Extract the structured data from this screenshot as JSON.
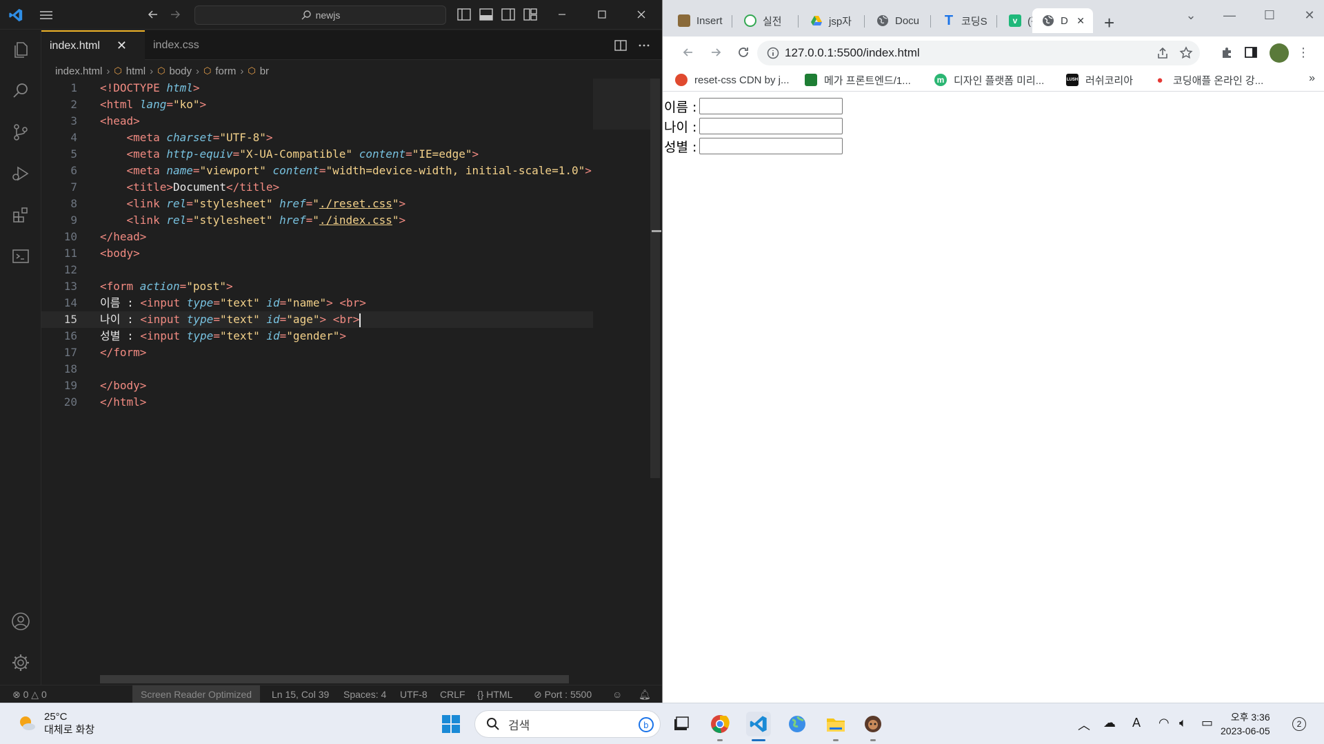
{
  "vscode": {
    "search_text": "newjs",
    "tabs": [
      {
        "label": "index.html",
        "active": true,
        "close": "✕"
      },
      {
        "label": "index.css",
        "active": false
      }
    ],
    "breadcrumb": [
      "index.html",
      "html",
      "body",
      "form",
      "br"
    ],
    "status": {
      "problems": "⊗ 0 △ 0",
      "screen_reader": "Screen Reader Optimized",
      "position": "Ln 15, Col 39",
      "spaces": "Spaces: 4",
      "encoding": "UTF-8",
      "eol": "CRLF",
      "language": "{} HTML",
      "port": "⊘ Port : 5500"
    },
    "current_line": 15,
    "code_lines": [
      [
        [
          "tag",
          "<!DOCTYPE "
        ],
        [
          "attr",
          "html"
        ],
        [
          "tag",
          ">"
        ]
      ],
      [
        [
          "tag",
          "<html "
        ],
        [
          "attr",
          "lang"
        ],
        [
          "tag",
          "="
        ],
        [
          "str",
          "\"ko\""
        ],
        [
          "tag",
          ">"
        ]
      ],
      [
        [
          "tag",
          "<head>"
        ]
      ],
      [
        [
          "txt",
          "    "
        ],
        [
          "tag",
          "<meta "
        ],
        [
          "attr",
          "charset"
        ],
        [
          "tag",
          "="
        ],
        [
          "str",
          "\"UTF-8\""
        ],
        [
          "tag",
          ">"
        ]
      ],
      [
        [
          "txt",
          "    "
        ],
        [
          "tag",
          "<meta "
        ],
        [
          "attr",
          "http-equiv"
        ],
        [
          "tag",
          "="
        ],
        [
          "str",
          "\"X-UA-Compatible\""
        ],
        [
          "txt",
          " "
        ],
        [
          "attr",
          "content"
        ],
        [
          "tag",
          "="
        ],
        [
          "str",
          "\"IE=edge\""
        ],
        [
          "tag",
          ">"
        ]
      ],
      [
        [
          "txt",
          "    "
        ],
        [
          "tag",
          "<meta "
        ],
        [
          "attr",
          "name"
        ],
        [
          "tag",
          "="
        ],
        [
          "str",
          "\"viewport\""
        ],
        [
          "txt",
          " "
        ],
        [
          "attr",
          "content"
        ],
        [
          "tag",
          "="
        ],
        [
          "str",
          "\"width=device-width, initial-scale=1.0\""
        ],
        [
          "tag",
          ">"
        ]
      ],
      [
        [
          "txt",
          "    "
        ],
        [
          "tag",
          "<title>"
        ],
        [
          "txt",
          "Document"
        ],
        [
          "tag",
          "</title>"
        ]
      ],
      [
        [
          "txt",
          "    "
        ],
        [
          "tag",
          "<link "
        ],
        [
          "attr",
          "rel"
        ],
        [
          "tag",
          "="
        ],
        [
          "str",
          "\"stylesheet\""
        ],
        [
          "txt",
          " "
        ],
        [
          "attr",
          "href"
        ],
        [
          "tag",
          "="
        ],
        [
          "str",
          "\""
        ],
        [
          "stru",
          "./reset.css"
        ],
        [
          "str",
          "\""
        ],
        [
          "tag",
          ">"
        ]
      ],
      [
        [
          "txt",
          "    "
        ],
        [
          "tag",
          "<link "
        ],
        [
          "attr",
          "rel"
        ],
        [
          "tag",
          "="
        ],
        [
          "str",
          "\"stylesheet\""
        ],
        [
          "txt",
          " "
        ],
        [
          "attr",
          "href"
        ],
        [
          "tag",
          "="
        ],
        [
          "str",
          "\""
        ],
        [
          "stru",
          "./index.css"
        ],
        [
          "str",
          "\""
        ],
        [
          "tag",
          ">"
        ]
      ],
      [
        [
          "tag",
          "</head>"
        ]
      ],
      [
        [
          "tag",
          "<body>"
        ]
      ],
      [],
      [
        [
          "tag",
          "<form "
        ],
        [
          "attr",
          "action"
        ],
        [
          "tag",
          "="
        ],
        [
          "str",
          "\"post\""
        ],
        [
          "tag",
          ">"
        ]
      ],
      [
        [
          "txt",
          "이름 : "
        ],
        [
          "tag",
          "<input "
        ],
        [
          "attr",
          "type"
        ],
        [
          "tag",
          "="
        ],
        [
          "str",
          "\"text\""
        ],
        [
          "txt",
          " "
        ],
        [
          "attr",
          "id"
        ],
        [
          "tag",
          "="
        ],
        [
          "str",
          "\"name\""
        ],
        [
          "tag",
          ">"
        ],
        [
          "txt",
          " "
        ],
        [
          "tag",
          "<br>"
        ]
      ],
      [
        [
          "txt",
          "나이 : "
        ],
        [
          "tag",
          "<input "
        ],
        [
          "attr",
          "type"
        ],
        [
          "tag",
          "="
        ],
        [
          "str",
          "\"text\""
        ],
        [
          "txt",
          " "
        ],
        [
          "attr",
          "id"
        ],
        [
          "tag",
          "="
        ],
        [
          "str",
          "\"age\""
        ],
        [
          "tag",
          ">"
        ],
        [
          "txt",
          " "
        ],
        [
          "tag",
          "<br>"
        ]
      ],
      [
        [
          "txt",
          "성별 : "
        ],
        [
          "tag",
          "<input "
        ],
        [
          "attr",
          "type"
        ],
        [
          "tag",
          "="
        ],
        [
          "str",
          "\"text\""
        ],
        [
          "txt",
          " "
        ],
        [
          "attr",
          "id"
        ],
        [
          "tag",
          "="
        ],
        [
          "str",
          "\"gender\""
        ],
        [
          "tag",
          ">"
        ]
      ],
      [
        [
          "tag",
          "</form>"
        ]
      ],
      [],
      [
        [
          "tag",
          "</body>"
        ]
      ],
      [
        [
          "tag",
          "</html>"
        ]
      ]
    ]
  },
  "chrome": {
    "tabs": [
      {
        "label": "Insert",
        "favicon": "#8a6a3a"
      },
      {
        "label": "실전",
        "favicon": "#34a853"
      },
      {
        "label": "jsp자",
        "favicon": "#fbbc04"
      },
      {
        "label": "Docu",
        "favicon": "#5f6368"
      },
      {
        "label": "코딩S",
        "favicon": "#1a73e8",
        "glyph": "T"
      },
      {
        "label": "(작성",
        "favicon": "#1fb87a",
        "glyph": "v"
      },
      {
        "label": "D",
        "favicon": "#5f6368",
        "active": true,
        "close": "✕"
      }
    ],
    "new_tab": "+",
    "url": "127.0.0.1:5500/index.html",
    "bookmarks": [
      {
        "label": "reset-css CDN by j...",
        "favicon": "#e04a2f"
      },
      {
        "label": "메가 프론트엔드/1...",
        "favicon": "#1e7e34"
      },
      {
        "label": "디자인 플랫폼 미리...",
        "favicon": "#2bb673"
      },
      {
        "label": "러쉬코리아",
        "favicon": "#111111"
      },
      {
        "label": "코딩애플 온라인 강...",
        "favicon": "#e53935"
      }
    ],
    "bookmarks_more": "»",
    "form": [
      {
        "label": "이름 :",
        "value": ""
      },
      {
        "label": "나이 :",
        "value": ""
      },
      {
        "label": "성별 :",
        "value": ""
      }
    ]
  },
  "taskbar": {
    "weather_temp": "25°C",
    "weather_desc": "대체로 화창",
    "search_placeholder": "검색",
    "time": "오후 3:36",
    "date": "2023-06-05",
    "notifications": "2"
  }
}
